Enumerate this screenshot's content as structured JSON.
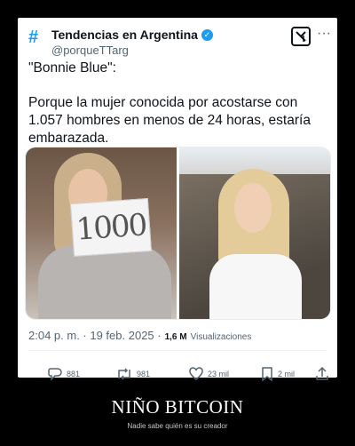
{
  "tweet": {
    "display_name": "Tendencias en Argentina",
    "handle": "@porqueTTarg",
    "line1": "\"Bonnie Blue\":",
    "line2": "Porque la mujer conocida por acostarse con 1.057 hombres en menos de 24 horas, estaría embarazada.",
    "sign_text": "1000",
    "timestamp": "2:04 p. m. · 19 feb. 2025 ·",
    "views_count": "1,6 M",
    "views_label": "Visualizaciones",
    "replies": "881",
    "retweets": "981",
    "likes": "23 mil",
    "bookmarks": "2 mil"
  },
  "icons": [
    "hashtag-icon",
    "verified-badge-icon",
    "grok-icon",
    "more-icon",
    "reply-icon",
    "retweet-icon",
    "like-icon",
    "bookmark-icon",
    "share-icon"
  ],
  "colors": {
    "accent": "#1d9bf0",
    "text": "#0f1419",
    "muted": "#536471",
    "background": "#000000"
  },
  "footer": {
    "title": "NIÑO BITCOIN",
    "subtitle": "Nadie sabe quién es su creador"
  }
}
